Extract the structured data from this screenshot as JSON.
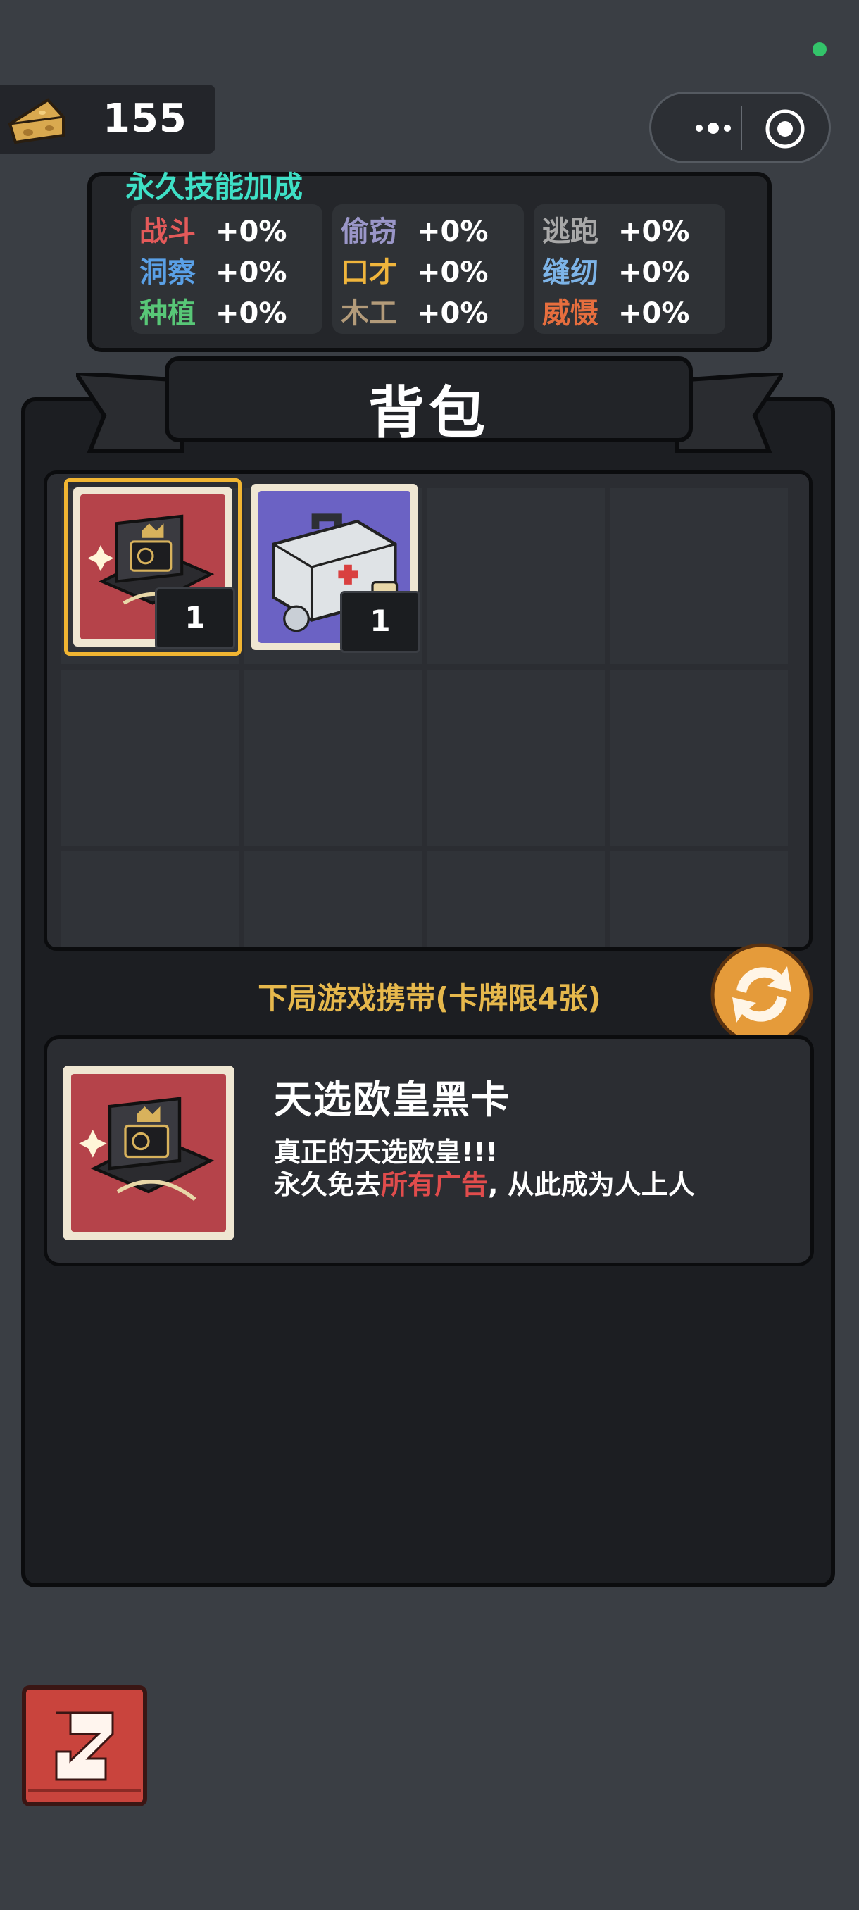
{
  "currency": {
    "icon": "cheese-icon",
    "value": "155"
  },
  "capsule": {
    "more_icon": "more-dots-icon",
    "close_icon": "close-target-icon"
  },
  "skills": {
    "title": "永久技能加成",
    "columns": [
      [
        {
          "name": "战斗",
          "value": "+0%",
          "color": "#e45a5a"
        },
        {
          "name": "洞察",
          "value": "+0%",
          "color": "#5aa0e6"
        },
        {
          "name": "种植",
          "value": "+0%",
          "color": "#58c777"
        }
      ],
      [
        {
          "name": "偷窃",
          "value": "+0%",
          "color": "#9a96c8"
        },
        {
          "name": "口才",
          "value": "+0%",
          "color": "#f0b53c"
        },
        {
          "name": "木工",
          "value": "+0%",
          "color": "#b39b7a"
        }
      ],
      [
        {
          "name": "逃跑",
          "value": "+0%",
          "color": "#a8a8a8"
        },
        {
          "name": "缝纫",
          "value": "+0%",
          "color": "#7db4e8"
        },
        {
          "name": "威慑",
          "value": "+0%",
          "color": "#e66e3e"
        }
      ]
    ]
  },
  "backpack": {
    "title": "背包",
    "items": [
      {
        "name": "天选欧皇黑卡",
        "qty": "1",
        "bg": "#b5434a",
        "selected": true
      },
      {
        "name": "medkit",
        "qty": "1",
        "bg": "#6b62c4",
        "selected": false
      }
    ]
  },
  "carry_text": "下局游戏携带(卡牌限4张)",
  "detail": {
    "name": "天选欧皇黑卡",
    "desc_line1": "真正的天选欧皇!!!",
    "desc_line2_a": "永久免去",
    "desc_line2_b": "所有广告",
    "desc_line2_c": ", 从此成为人上人"
  },
  "colors": {
    "accent": "#f1b532",
    "highlight": "#e04c4c",
    "title_teal": "#3ee0c6",
    "carry_gold": "#e6b84c"
  }
}
